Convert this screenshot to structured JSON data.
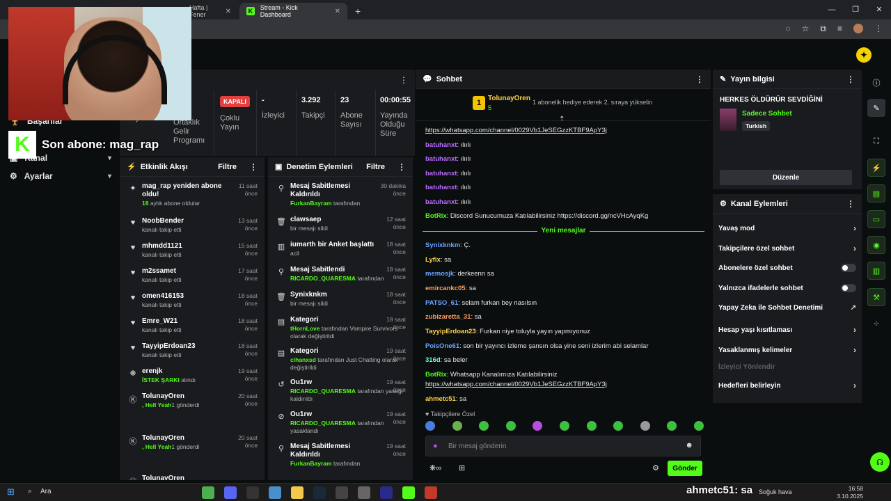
{
  "browser": {
    "tabs": [
      {
        "title": "Hafta | Fener"
      },
      {
        "title": "Stream - Kick Dashboard"
      }
    ],
    "new_tab": "+",
    "win": {
      "min": "—",
      "max": "❐",
      "close": "✕"
    }
  },
  "overlay": {
    "sub_alert": "Son abone: mag_rap",
    "chat_alert": "ahmetc51: sa"
  },
  "leftnav": {
    "items": [
      {
        "label": "Başarılar"
      },
      {
        "label": "Kanal"
      },
      {
        "label": "Ayarlar"
      }
    ]
  },
  "stats": {
    "col0_label": "Yayın",
    "col1_label": "Ortaklık Gelir Programı",
    "kapali": "KAPALI",
    "multi_label": "Çoklu Yayın",
    "viewers_value": "-",
    "viewers_label": "İzleyici",
    "followers_value": "3.292",
    "followers_label": "Takipçi",
    "subs_value": "23",
    "subs_label": "Abone Sayısı",
    "uptime_value": "00:00:55",
    "uptime_label": "Yayında Olduğu Süre"
  },
  "activity": {
    "title": "Etkinlik Akışı",
    "filter": "Filtre",
    "items": [
      {
        "icon": "✦",
        "name": "mag_rap yeniden abone oldu!",
        "sub_g": "18",
        "sub": " aylık abone oldular",
        "time": "11 saat önce"
      },
      {
        "icon": "♥",
        "name": "NoobBender",
        "sub": "kanalı takip etti",
        "time": "13 saat önce"
      },
      {
        "icon": "♥",
        "name": "mhmdd1121",
        "sub": "kanalı takip etti",
        "time": "15 saat önce"
      },
      {
        "icon": "♥",
        "name": "m2ssamet",
        "sub": "kanalı takip etti",
        "time": "17 saat önce"
      },
      {
        "icon": "♥",
        "name": "omen416153",
        "sub": "kanalı takip etti",
        "time": "18 saat önce"
      },
      {
        "icon": "♥",
        "name": "Emre_W21",
        "sub": "kanalı takip etti",
        "time": "18 saat önce"
      },
      {
        "icon": "♥",
        "name": "TayyipErdoan23",
        "sub": "kanalı takip etti",
        "time": "18 saat önce"
      },
      {
        "icon": "❋",
        "name": "erenjk",
        "sub_g": "İSTEK ŞARKI",
        "sub": " alındı",
        "time": "19 saat önce"
      },
      {
        "icon": "Ⓚ",
        "name": "TolunayOren",
        "sub_g": ", Hell Yeah",
        "sub": "1 gönderdi",
        "time": "20 saat önce"
      },
      {
        "icon": "Ⓚ",
        "name": "TolunayOren",
        "sub_g": ", Hell Yeah",
        "sub": "1 gönderdi",
        "time": "20 saat önce"
      },
      {
        "icon": "Ⓚ",
        "name": "TolunayOren",
        "sub": "",
        "time": ""
      }
    ]
  },
  "moderation": {
    "title": "Denetim Eylemleri",
    "filter": "Filtre",
    "items": [
      {
        "icon": "⚲",
        "name": "Mesaj Sabitlemesi Kaldırıldı",
        "sub_g": "FurkanBayram",
        "sub": " tarafından",
        "time": "30 dakika önce"
      },
      {
        "icon": "🗑",
        "name": "clawsaep",
        "sub": "bir mesajı sildi",
        "time": "12 saat önce"
      },
      {
        "icon": "▥",
        "name": "iumarth bir Anket başlattı",
        "sub": "acil",
        "time": "18 saat önce"
      },
      {
        "icon": "⚲",
        "name": "Mesaj Sabitlendi",
        "sub_g": "RICARDO_QUARESMA",
        "sub": " tarafından",
        "time": "18 saat önce"
      },
      {
        "icon": "🗑",
        "name": "Synixknkm",
        "sub": "bir mesajı sildi",
        "time": "18 saat önce"
      },
      {
        "icon": "▤",
        "name": "Kategori",
        "sub_g": "tHornLove",
        "sub": " tarafından Vampire Survivors olarak değiştirildi",
        "time": "18 saat önce"
      },
      {
        "icon": "▤",
        "name": "Kategori",
        "sub_g": "cihanxsd",
        "sub": " tarafından Just Chatting olarak değiştirildi",
        "time": "19 saat önce"
      },
      {
        "icon": "↺",
        "name": "Ou1rw",
        "sub_g": "RICARDO_QUARESMA",
        "sub": " tarafından yasağı kaldırıldı",
        "time": "19 saat önce"
      },
      {
        "icon": "⊘",
        "name": "Ou1rw",
        "sub_g": "RICARDO_QUARESMA",
        "sub": " tarafından yasaklandı",
        "time": "19 saat önce"
      },
      {
        "icon": "⚲",
        "name": "Mesaj Sabitlemesi Kaldırıldı",
        "sub_g": "FurkanBayram",
        "sub": " tarafından",
        "time": "19 saat önce"
      }
    ]
  },
  "chat": {
    "title": "Sohbet",
    "pinned_user": "TolunayOren",
    "pinned_count": "5",
    "pinned_text": "1 abonelik hediye ederek 2. sıraya yükselin",
    "new_messages": "Yeni mesajlar",
    "messages": [
      {
        "u": "",
        "c": "#e6e6e6",
        "t": "https://whatsapp.com/channel/0029Vb1JeSEGzzKTBF9ApY3j",
        "link": true
      },
      {
        "u": "batuhanxt",
        "c": "#b96cff",
        "t": " ılıılı"
      },
      {
        "u": "batuhanxt",
        "c": "#b96cff",
        "t": " ılıılı"
      },
      {
        "u": "batuhanxt",
        "c": "#b96cff",
        "t": " ılıılı"
      },
      {
        "u": "batuhanxt",
        "c": "#b96cff",
        "t": " ılıılı"
      },
      {
        "u": "batuhanxt",
        "c": "#b96cff",
        "t": " ılıılı"
      },
      {
        "u": "BotRix",
        "c": "#53fc18",
        "t": " Discord Sunucumuza Katılabilirsiniz https://discord.gg/ncVHcAyqKg"
      },
      {
        "u": "Synixknkm",
        "c": "#6aa3ff",
        "t": " Ç."
      },
      {
        "u": "Lyfix",
        "c": "#ffd24a",
        "t": " sa"
      },
      {
        "u": "memosjk",
        "c": "#6aa3ff",
        "t": " derkeenn sa"
      },
      {
        "u": "emircankc05",
        "c": "#ff9d5c",
        "t": " sa"
      },
      {
        "u": "PATSO_61",
        "c": "#6aa3ff",
        "t": " selam furkan bey nasılsın"
      },
      {
        "u": "zubizaretta_31",
        "c": "#ff9d5c",
        "t": " sa"
      },
      {
        "u": "TayyipErdoan23",
        "c": "#ffd24a",
        "t": " Furkan niye toluyla yayın yapmıyonuz"
      },
      {
        "u": "PoisOne61",
        "c": "#6aa3ff",
        "t": " son bir yayıncı izleme şansın olsa yine seni izlerim abi selamlar"
      },
      {
        "u": "316d",
        "c": "#6affc1",
        "t": " sa beler"
      },
      {
        "u": "BotRix",
        "c": "#53fc18",
        "t": " Whatsapp Kanalımıza Katılabilirsiniz"
      },
      {
        "u": "",
        "c": "#e6e6e6",
        "t": "https://whatsapp.com/channel/0029Vb1JeSEGzzKTBF9ApY3j",
        "link": true
      },
      {
        "u": "ahmetc51",
        "c": "#ffd24a",
        "t": " sa"
      }
    ],
    "followers_only": "Takipçilere Özel",
    "placeholder": "Bir mesaj gönderin",
    "send": "Gönder"
  },
  "info": {
    "title": "Yayın bilgisi",
    "stream_title": "HERKES ÖLDÜRÜR SEVDİĞİNİ",
    "category": "Sadece Sohbet",
    "lang": "Turkish",
    "edit": "Düzenle"
  },
  "channel": {
    "title": "Kanal Eylemleri",
    "items": [
      {
        "label": "Yavaş mod",
        "kind": "chev"
      },
      {
        "label": "Takipçilere özel sohbet",
        "kind": "chev"
      },
      {
        "label": "Abonelere özel sohbet",
        "kind": "toggle"
      },
      {
        "label": "Yalnızca ifadelerle sohbet",
        "kind": "toggle"
      },
      {
        "label": "Yapay Zeka ile Sohbet Denetimi",
        "kind": "ext"
      },
      {
        "label": "Hesap yaşı kısıtlaması",
        "kind": "chev"
      },
      {
        "label": "Yasaklanmış kelimeler",
        "kind": "chev"
      },
      {
        "label": "İzleyici Yönlendir",
        "kind": "none"
      },
      {
        "label": "Hedefleri belirleyin",
        "kind": "chev"
      }
    ]
  },
  "taskbar": {
    "search": "Ara",
    "weather": "Soğuk hava",
    "time": "16:58",
    "date": "3.10.2025"
  }
}
